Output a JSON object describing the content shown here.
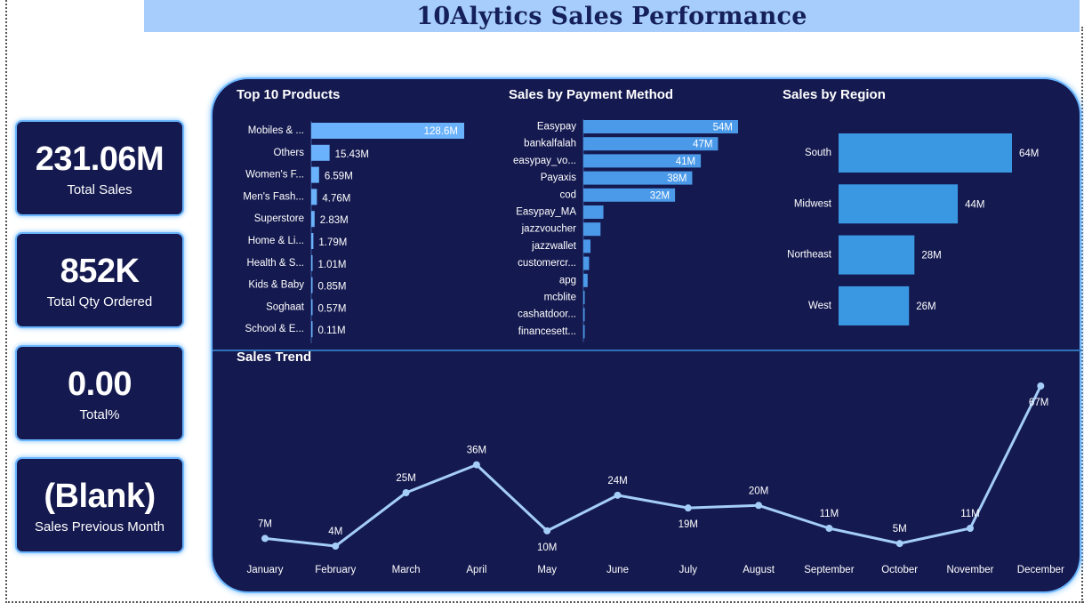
{
  "header": {
    "title": "10Alytics Sales Performance"
  },
  "kpis": [
    {
      "value": "231.06M",
      "label": "Total Sales"
    },
    {
      "value": "852K",
      "label": "Total Qty Ordered"
    },
    {
      "value": "0.00",
      "label": "Total%"
    },
    {
      "value": "(Blank)",
      "label": "Sales Previous Month"
    }
  ],
  "colors": {
    "panel": "#14194f",
    "title_bar": "#a6cdfb",
    "product_bar": "#6ab2fb",
    "payment_bar": "#4b9ae9",
    "region_bar": "#3a98e3",
    "trend_line": "#a4cdf8",
    "border_glow": "#6cb6ff"
  },
  "chart_data": [
    {
      "type": "bar",
      "orientation": "horizontal",
      "title": "Top 10 Products",
      "categories": [
        "Mobiles & ...",
        "Others",
        "Women's F...",
        "Men's Fash...",
        "Superstore",
        "Home & Li...",
        "Health & S...",
        "Kids & Baby",
        "Soghaat",
        "School & E..."
      ],
      "values": [
        128.6,
        15.43,
        6.59,
        4.76,
        2.83,
        1.79,
        1.01,
        0.85,
        0.57,
        0.11
      ],
      "labels": [
        "128.6M",
        "15.43M",
        "6.59M",
        "4.76M",
        "2.83M",
        "1.79M",
        "1.01M",
        "0.85M",
        "0.57M",
        "0.11M"
      ],
      "unit": "M"
    },
    {
      "type": "bar",
      "orientation": "horizontal",
      "title": "Sales by Payment Method",
      "categories": [
        "Easypay",
        "bankalfalah",
        "easypay_vo...",
        "Payaxis",
        "cod",
        "Easypay_MA",
        "jazzvoucher",
        "jazzwallet",
        "customercr...",
        "apg",
        "mcblite",
        "cashatdoor...",
        "financesett..."
      ],
      "values": [
        54,
        47,
        41,
        38,
        32,
        7,
        6,
        2.5,
        2,
        1.5,
        0.4,
        0.3,
        0.2
      ],
      "labels": [
        "54M",
        "47M",
        "41M",
        "38M",
        "32M",
        "",
        "",
        "",
        "",
        "",
        "",
        "",
        ""
      ],
      "unit": "M"
    },
    {
      "type": "bar",
      "orientation": "horizontal",
      "title": "Sales by Region",
      "categories": [
        "South",
        "Midwest",
        "Northeast",
        "West"
      ],
      "values": [
        64,
        44,
        28,
        26
      ],
      "labels": [
        "64M",
        "44M",
        "28M",
        "26M"
      ],
      "unit": "M"
    },
    {
      "type": "line",
      "title": "Sales Trend",
      "x": [
        "January",
        "February",
        "March",
        "April",
        "May",
        "June",
        "July",
        "August",
        "September",
        "October",
        "November",
        "December"
      ],
      "values": [
        7,
        4,
        25,
        36,
        10,
        24,
        19,
        20,
        11,
        5,
        11,
        67
      ],
      "labels": [
        "7M",
        "4M",
        "25M",
        "36M",
        "10M",
        "24M",
        "19M",
        "20M",
        "11M",
        "5M",
        "11M",
        "67M"
      ],
      "unit": "M"
    }
  ]
}
